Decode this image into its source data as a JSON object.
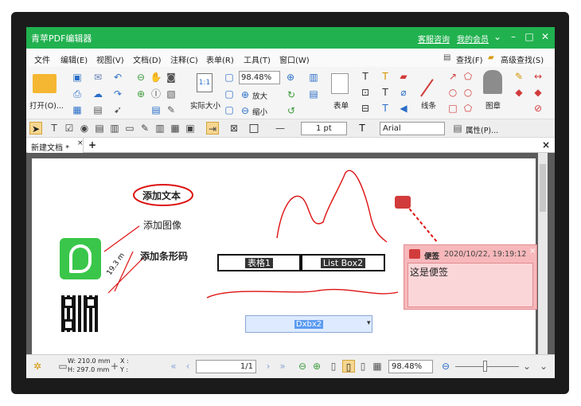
{
  "app": {
    "title": "青苹PDF编辑器",
    "links": [
      "客服咨询",
      "我的会员"
    ]
  },
  "menu": [
    "文件",
    "编辑(E)",
    "视图(V)",
    "文档(D)",
    "注释(C)",
    "表单(R)",
    "工具(T)",
    "窗口(W)"
  ],
  "menu_right": [
    "查找(F)",
    "高级查找(S)"
  ],
  "ribbon": {
    "open": "打开(O)...",
    "actual": "实际大小",
    "zoom": "98.48%",
    "zoom_in": "放大",
    "zoom_out": "缩小",
    "form": "表单",
    "line": "线条",
    "seal": "图章"
  },
  "toolbar2": {
    "line_width": "1 pt",
    "font": "Arial",
    "props": "属性(P)..."
  },
  "tab": {
    "name": "新建文档 *",
    "close": "×",
    "add": "+"
  },
  "page": {
    "add_text": "添加文本",
    "add_image": "添加图像",
    "add_barcode": "添加条形码",
    "dimension": "19.3 m",
    "field1": "表格1",
    "field2": "List Box2",
    "field3": "Dxbx2"
  },
  "note": {
    "title": "便签",
    "date": "2020/10/22, 19:19:12",
    "body": "这是便签"
  },
  "status": {
    "w": "W: 210.0 mm",
    "h": "H: 297.0 mm",
    "x": "X :",
    "y": "Y :",
    "page": "1/1",
    "zoom": "98.48%"
  }
}
